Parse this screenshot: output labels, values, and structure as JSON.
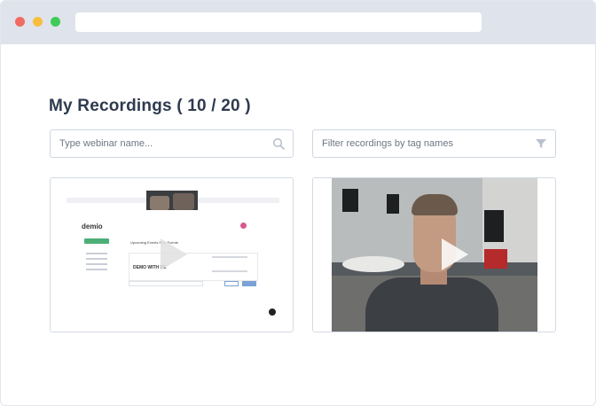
{
  "page": {
    "title": "My Recordings ( 10 / 20 )"
  },
  "search": {
    "placeholder": "Type webinar name...",
    "icon": "search-icon"
  },
  "filter": {
    "placeholder": "Filter recordings by tag names",
    "icon": "filter-icon"
  },
  "recordings": [
    {
      "thumbnail": {
        "app_logo": "demio",
        "tabs_text": "Upcoming Events   Past Events",
        "event_title": "DEMO WITH DE"
      }
    },
    {
      "thumbnail": {}
    }
  ],
  "colors": {
    "chrome": "#dfe3ec",
    "title": "#2e3a4e",
    "border": "#cfd6e2",
    "placeholder": "#6d7685"
  }
}
